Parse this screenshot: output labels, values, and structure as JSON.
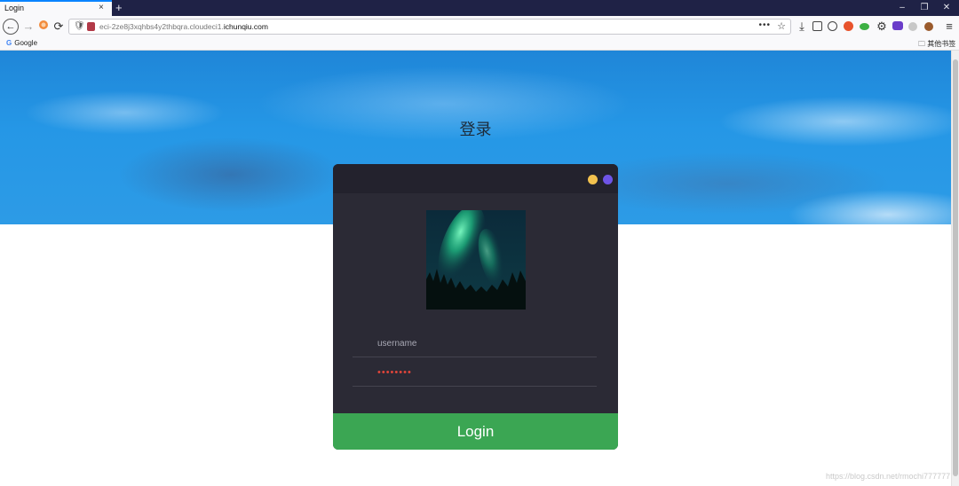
{
  "browser": {
    "tab_title": "Login",
    "tab_close": "×",
    "new_tab": "+",
    "url_host_prefix": "eci-2ze8j3xqhbs4y2thbqra.cloudeci1.",
    "url_host_domain": "ichunqiu.com",
    "url_more": "•••",
    "bookmark_google": "Google",
    "bookmark_other": "其他书签",
    "window_controls": {
      "minimize": "–",
      "restore": "❐",
      "close": "✕"
    }
  },
  "page": {
    "heading": "登录",
    "login_card": {
      "username_placeholder": "username",
      "password_value": "••••••••",
      "login_button": "Login",
      "dot_colors": [
        "#f2c14e",
        "#6e54e6"
      ]
    },
    "watermark": "https://blog.csdn.net/rmochi777777"
  },
  "colors": {
    "login_button": "#3ba653",
    "card_background": "#2b2a35",
    "password_text": "#e0453a"
  }
}
